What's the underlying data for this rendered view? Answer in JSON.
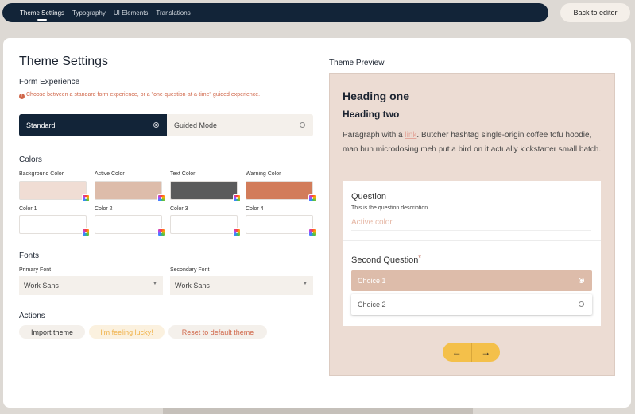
{
  "nav": {
    "tabs": [
      {
        "label": "Theme Settings",
        "active": true
      },
      {
        "label": "Typography",
        "active": false
      },
      {
        "label": "UI Elements",
        "active": false
      },
      {
        "label": "Translations",
        "active": false
      }
    ],
    "back_label": "Back to editor"
  },
  "settings": {
    "title": "Theme Settings",
    "form_experience": {
      "heading": "Form Experience",
      "hint": "Choose between a standard form experience, or a \"one-question-at-a-time\" guided experience.",
      "options": [
        {
          "label": "Standard",
          "selected": true
        },
        {
          "label": "Guided Mode",
          "selected": false
        }
      ]
    },
    "colors": {
      "heading": "Colors",
      "swatches": [
        {
          "label": "Background Color",
          "color": "#f0ddd4"
        },
        {
          "label": "Active Color",
          "color": "#ddbcaa"
        },
        {
          "label": "Text Color",
          "color": "#5b5b5b"
        },
        {
          "label": "Warning Color",
          "color": "#d27c5a"
        },
        {
          "label": "Color 1",
          "color": "#ffffff"
        },
        {
          "label": "Color 2",
          "color": "#ffffff"
        },
        {
          "label": "Color 3",
          "color": "#ffffff"
        },
        {
          "label": "Color 4",
          "color": "#ffffff"
        }
      ]
    },
    "fonts": {
      "heading": "Fonts",
      "primary_label": "Primary Font",
      "primary_value": "Work Sans",
      "secondary_label": "Secondary Font",
      "secondary_value": "Work Sans"
    },
    "actions": {
      "heading": "Actions",
      "import_label": "Import theme",
      "lucky_label": "I'm feeling lucky!",
      "reset_label": "Reset to default theme"
    }
  },
  "preview": {
    "title": "Theme Preview",
    "heading_one": "Heading one",
    "heading_two": "Heading two",
    "para_before": "Paragraph with a ",
    "para_link": "link",
    "para_after": ". Butcher hashtag single-origin coffee tofu hoodie, man bun microdosing meh put a bird on it actually kickstarter small batch.",
    "question1": "Question",
    "question1_desc": "This is the question description.",
    "question1_placeholder": "Active color",
    "question2": "Second Question",
    "required_mark": "*",
    "choices": [
      {
        "label": "Choice 1",
        "selected": true
      },
      {
        "label": "Choice 2",
        "selected": false
      }
    ],
    "prev_icon": "←",
    "next_icon": "→"
  },
  "colors": {
    "nav_bg": "#122438",
    "accent_yellow": "#f4c04a",
    "warning": "#d0674a"
  }
}
